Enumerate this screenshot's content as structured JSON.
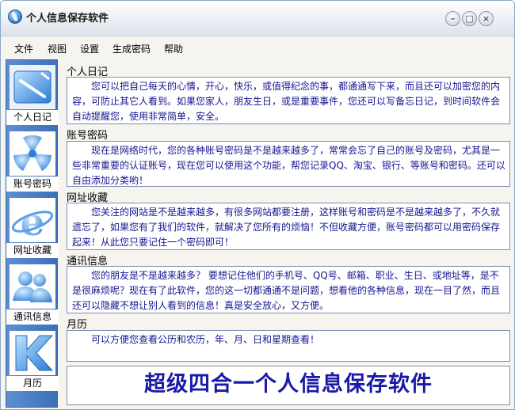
{
  "window": {
    "title": "个人信息保存软件",
    "controls": {
      "minimize": "–",
      "maximize": "□",
      "close": "×"
    }
  },
  "menu": {
    "items": [
      "文件",
      "视图",
      "设置",
      "生成密码",
      "帮助"
    ]
  },
  "sidebar": {
    "items": [
      {
        "label": "个人日记",
        "icon": "diary-icon"
      },
      {
        "label": "账号密码",
        "icon": "key-icon"
      },
      {
        "label": "网址收藏",
        "icon": "browser-icon"
      },
      {
        "label": "通讯信息",
        "icon": "contacts-icon"
      },
      {
        "label": "月历",
        "icon": "calendar-icon"
      }
    ]
  },
  "sections": [
    {
      "title": "个人日记",
      "text": "您可以把自己每天的心情，开心，快乐，或值得纪念的事，都通通写下来，而且还可以加密您的内容，可防止其它人看到。如果您家人，朋友生日，或是重要事件，您还可以写备忘日记，到时间软件会自动提醒您，使用非常简单，安全。"
    },
    {
      "title": "账号密码",
      "text": "现在是网络时代，您的各种账号密码是不是越来越多了，常常会忘了自己的账号及密码，尤其是一些非常重要的认证账号，现在您可以使用这个功能，帮您记录QQ、淘宝、银行、等账号和密码。还可以自由添加分类哟！"
    },
    {
      "title": "网址收藏",
      "text": "您关注的网站是不是越来越多，有很多网站都要注册，这样账号和密码是不是越来越多了，不久就遗忘了，如果您有了我们的软件，就解决了您所有的烦恼！不但收藏方便，账号密码都可以用密码保存起来！从此您只要记住一个密码即可！"
    },
    {
      "title": "通讯信息",
      "text": "您的朋友是不是越来越多？ 要想记住他们的手机号、QQ号、邮箱、职业、生日、或地址等，是不是很麻烦呢？现在有了此软件，您的这一切都通通不是问题，想看他的各种信息，现在一目了然，而且还可以隐藏不想让别人看到的信息！真是安全放心，又方便。"
    },
    {
      "title": "月历",
      "text": "可以方便您查看公历和农历，年、月、日和星期查看！"
    }
  ],
  "banner": "超级四合一个人信息保存软件"
}
